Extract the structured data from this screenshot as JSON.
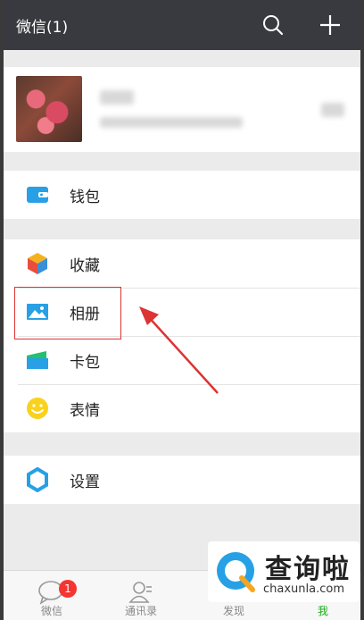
{
  "header": {
    "title": "微信(1)",
    "search_icon": "search-icon",
    "add_icon": "plus-icon"
  },
  "menu": {
    "wallet": "钱包",
    "favorites": "收藏",
    "album": "相册",
    "cards": "卡包",
    "stickers": "表情",
    "settings": "设置"
  },
  "bottom_tabs": [
    {
      "label": "微信",
      "badge": "1"
    },
    {
      "label": "通讯录"
    },
    {
      "label": "发现"
    },
    {
      "label": "我"
    }
  ],
  "watermark": {
    "text": "查询啦",
    "url": "chaxunla.com"
  },
  "colors": {
    "header_bg": "#393a3f",
    "active_tab": "#1aad19",
    "badge": "#f43530",
    "annotation": "#dd3333"
  }
}
